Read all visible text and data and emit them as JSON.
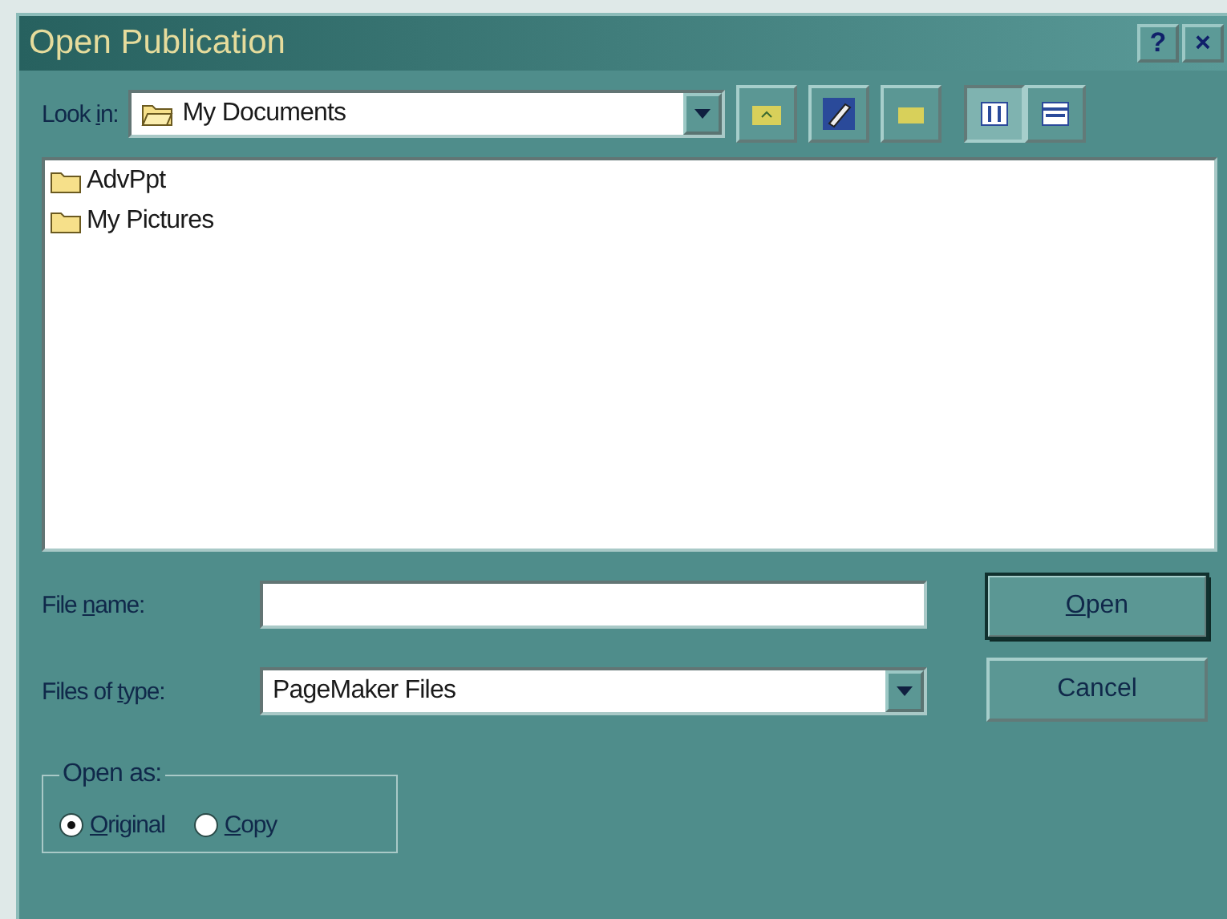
{
  "window": {
    "title": "Open Publication",
    "title_buttons": [
      "?",
      "×"
    ]
  },
  "look_in": {
    "label": {
      "pre": "Look ",
      "key": "i",
      "post": "n:"
    },
    "value": "My Documents"
  },
  "files": [
    {
      "name": "AdvPpt"
    },
    {
      "name": "My Pictures"
    }
  ],
  "file_name": {
    "label": {
      "pre": "File ",
      "key": "n",
      "post": "ame:"
    }
  },
  "files_of_type": {
    "label": {
      "pre": "Files of ",
      "key": "t",
      "post": "ype:"
    },
    "value": "PageMaker Files"
  },
  "buttons": [
    {
      "label": {
        "key": "O",
        "post": "pen"
      },
      "default": true
    },
    {
      "label": {
        "post": "Cancel"
      },
      "default": false
    }
  ],
  "open_as": {
    "title": "Open as:",
    "options": [
      {
        "label": {
          "key": "O",
          "post": "riginal"
        },
        "selected": true
      },
      {
        "label": {
          "key": "C",
          "post": "opy"
        },
        "selected": false
      }
    ]
  }
}
